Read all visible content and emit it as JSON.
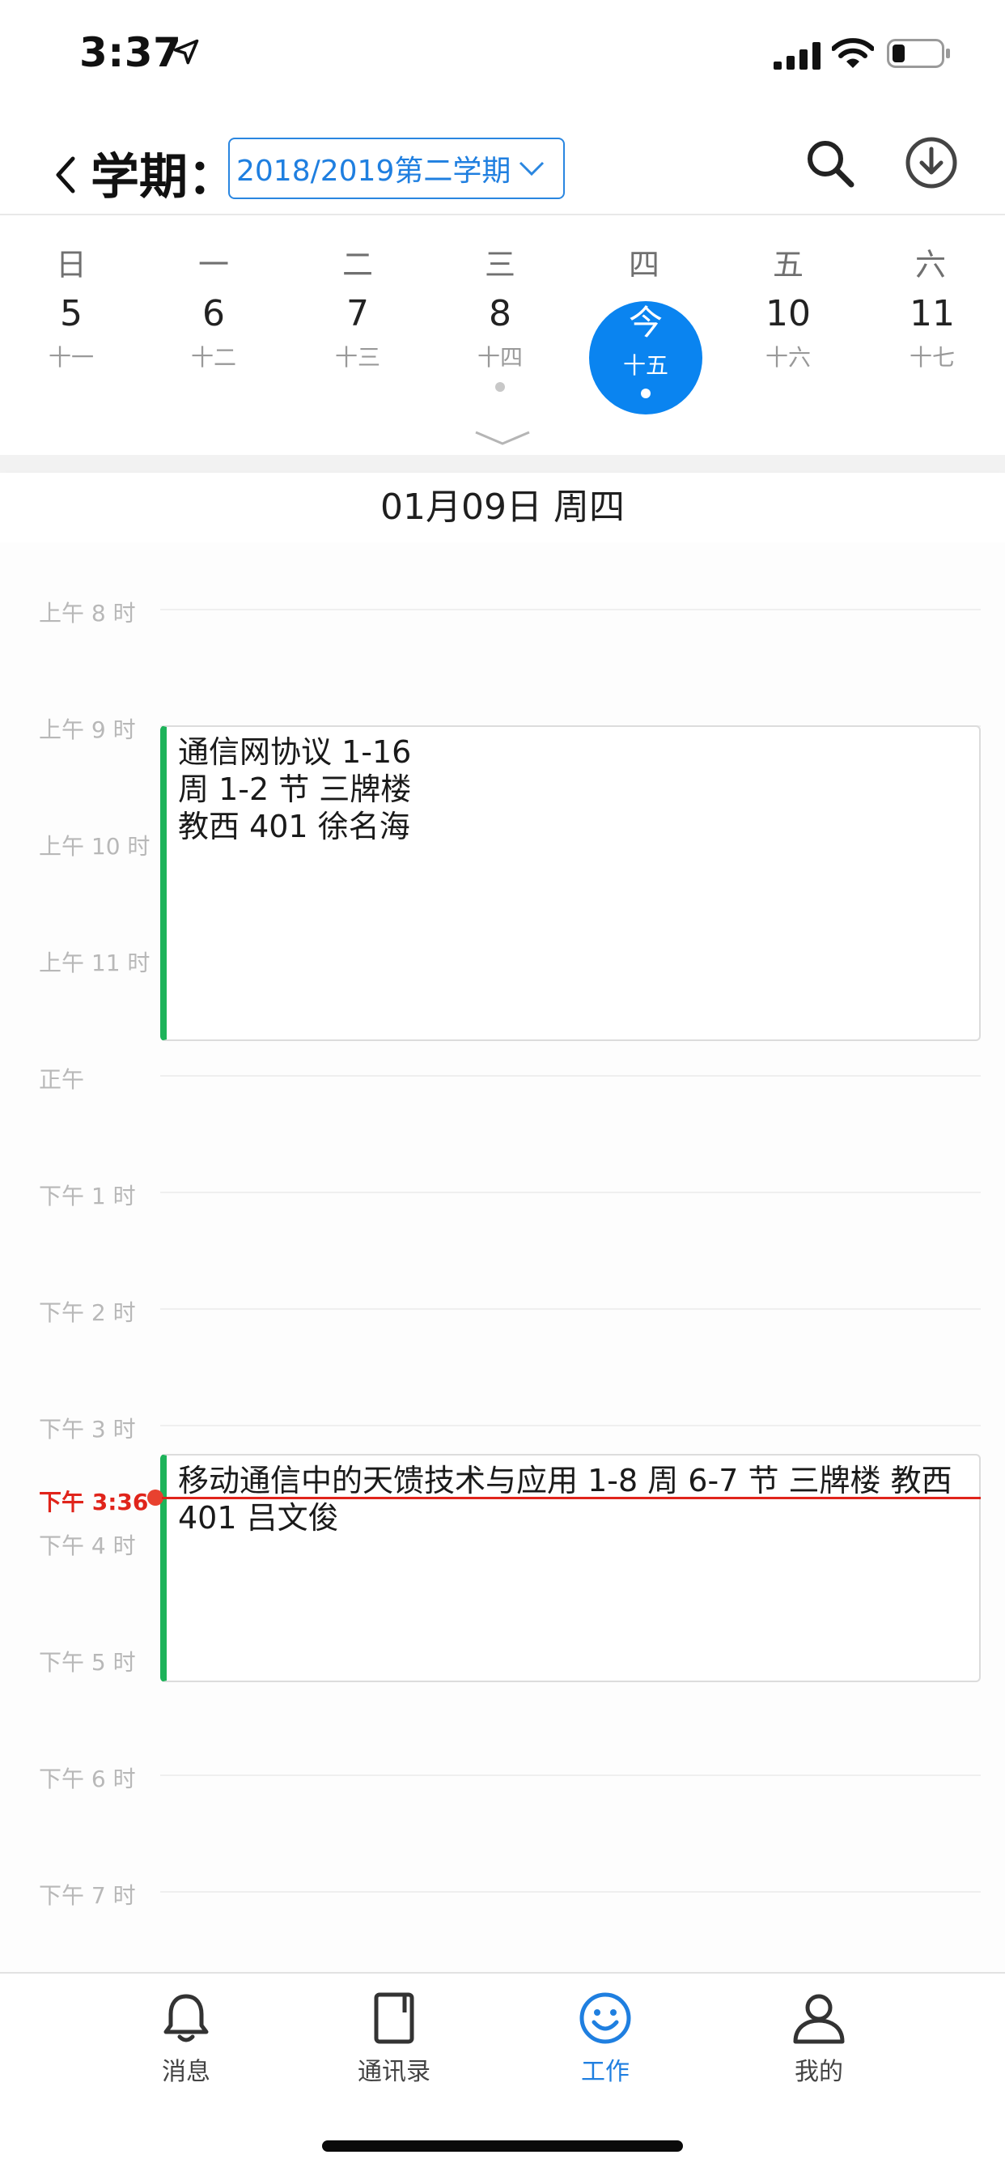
{
  "status_bar": {
    "time": "3:37"
  },
  "nav": {
    "title": "学期：",
    "term_selected": "2018/2019第二学期",
    "icons": {
      "back": "chevron-left-icon",
      "search": "search-icon",
      "download": "download-icon"
    }
  },
  "week": {
    "weekdays": [
      "日",
      "一",
      "二",
      "三",
      "四",
      "五",
      "六"
    ],
    "days": [
      {
        "num": "5",
        "lunar": "十一",
        "dot": false
      },
      {
        "num": "6",
        "lunar": "十二",
        "dot": false
      },
      {
        "num": "7",
        "lunar": "十三",
        "dot": false
      },
      {
        "num": "8",
        "lunar": "十四",
        "dot": true
      },
      {
        "num": "今",
        "lunar": "十五",
        "dot": true,
        "today": true
      },
      {
        "num": "10",
        "lunar": "十六",
        "dot": false
      },
      {
        "num": "11",
        "lunar": "十七",
        "dot": false
      }
    ],
    "accent_color": "#0a84f0"
  },
  "selected_date": "01月09日 周四",
  "timeline": {
    "hours": [
      "上午 8 时",
      "上午 9 时",
      "上午 10 时",
      "上午 11 时",
      "正午",
      "下午 1 时",
      "下午 2 时",
      "下午 3 时",
      "下午 4 时",
      "下午 5 时",
      "下午 6 时",
      "下午 7 时"
    ],
    "now_label": "下午 3:36",
    "now_color": "#e0241b",
    "events": [
      {
        "lines": [
          "通信网协议 1-16",
          "周 1-2 节 三牌楼",
          "教西 401 徐名海"
        ],
        "color": "#1db35a"
      },
      {
        "lines": [
          "移动通信中的天馈技术与应用 1-8 周 6-7 节 三牌楼 教西",
          "401 吕文俊"
        ],
        "color": "#1db35a"
      }
    ]
  },
  "tabbar": {
    "tabs": [
      {
        "label": "消息",
        "icon": "bell-icon"
      },
      {
        "label": "通讯录",
        "icon": "contacts-book-icon"
      },
      {
        "label": "工作",
        "icon": "smiley-icon",
        "active": true
      },
      {
        "label": "我的",
        "icon": "user-icon"
      }
    ],
    "active_color": "#1f7fe0"
  }
}
